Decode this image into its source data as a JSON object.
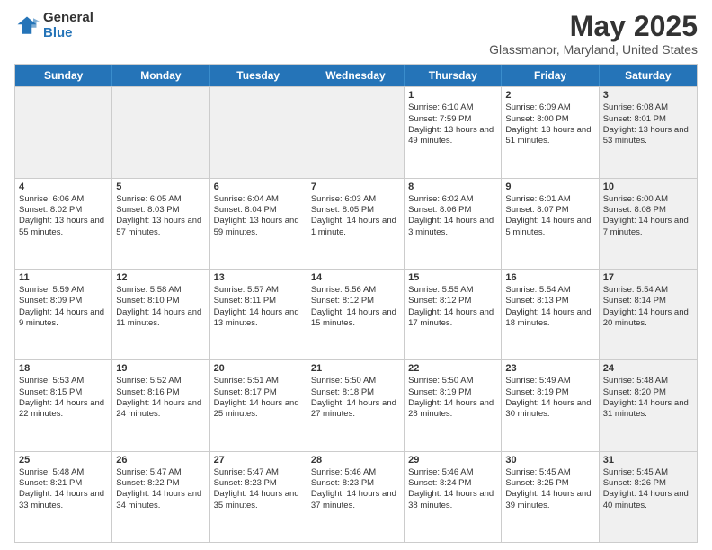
{
  "logo": {
    "general": "General",
    "blue": "Blue"
  },
  "header": {
    "month": "May 2025",
    "location": "Glassmanor, Maryland, United States"
  },
  "weekdays": [
    "Sunday",
    "Monday",
    "Tuesday",
    "Wednesday",
    "Thursday",
    "Friday",
    "Saturday"
  ],
  "rows": [
    [
      {
        "day": "",
        "sunrise": "",
        "sunset": "",
        "daylight": "",
        "shaded": true
      },
      {
        "day": "",
        "sunrise": "",
        "sunset": "",
        "daylight": "",
        "shaded": true
      },
      {
        "day": "",
        "sunrise": "",
        "sunset": "",
        "daylight": "",
        "shaded": true
      },
      {
        "day": "",
        "sunrise": "",
        "sunset": "",
        "daylight": "",
        "shaded": true
      },
      {
        "day": "1",
        "sunrise": "Sunrise: 6:10 AM",
        "sunset": "Sunset: 7:59 PM",
        "daylight": "Daylight: 13 hours and 49 minutes."
      },
      {
        "day": "2",
        "sunrise": "Sunrise: 6:09 AM",
        "sunset": "Sunset: 8:00 PM",
        "daylight": "Daylight: 13 hours and 51 minutes."
      },
      {
        "day": "3",
        "sunrise": "Sunrise: 6:08 AM",
        "sunset": "Sunset: 8:01 PM",
        "daylight": "Daylight: 13 hours and 53 minutes.",
        "shaded": true
      }
    ],
    [
      {
        "day": "4",
        "sunrise": "Sunrise: 6:06 AM",
        "sunset": "Sunset: 8:02 PM",
        "daylight": "Daylight: 13 hours and 55 minutes."
      },
      {
        "day": "5",
        "sunrise": "Sunrise: 6:05 AM",
        "sunset": "Sunset: 8:03 PM",
        "daylight": "Daylight: 13 hours and 57 minutes."
      },
      {
        "day": "6",
        "sunrise": "Sunrise: 6:04 AM",
        "sunset": "Sunset: 8:04 PM",
        "daylight": "Daylight: 13 hours and 59 minutes."
      },
      {
        "day": "7",
        "sunrise": "Sunrise: 6:03 AM",
        "sunset": "Sunset: 8:05 PM",
        "daylight": "Daylight: 14 hours and 1 minute."
      },
      {
        "day": "8",
        "sunrise": "Sunrise: 6:02 AM",
        "sunset": "Sunset: 8:06 PM",
        "daylight": "Daylight: 14 hours and 3 minutes."
      },
      {
        "day": "9",
        "sunrise": "Sunrise: 6:01 AM",
        "sunset": "Sunset: 8:07 PM",
        "daylight": "Daylight: 14 hours and 5 minutes."
      },
      {
        "day": "10",
        "sunrise": "Sunrise: 6:00 AM",
        "sunset": "Sunset: 8:08 PM",
        "daylight": "Daylight: 14 hours and 7 minutes.",
        "shaded": true
      }
    ],
    [
      {
        "day": "11",
        "sunrise": "Sunrise: 5:59 AM",
        "sunset": "Sunset: 8:09 PM",
        "daylight": "Daylight: 14 hours and 9 minutes."
      },
      {
        "day": "12",
        "sunrise": "Sunrise: 5:58 AM",
        "sunset": "Sunset: 8:10 PM",
        "daylight": "Daylight: 14 hours and 11 minutes."
      },
      {
        "day": "13",
        "sunrise": "Sunrise: 5:57 AM",
        "sunset": "Sunset: 8:11 PM",
        "daylight": "Daylight: 14 hours and 13 minutes."
      },
      {
        "day": "14",
        "sunrise": "Sunrise: 5:56 AM",
        "sunset": "Sunset: 8:12 PM",
        "daylight": "Daylight: 14 hours and 15 minutes."
      },
      {
        "day": "15",
        "sunrise": "Sunrise: 5:55 AM",
        "sunset": "Sunset: 8:12 PM",
        "daylight": "Daylight: 14 hours and 17 minutes."
      },
      {
        "day": "16",
        "sunrise": "Sunrise: 5:54 AM",
        "sunset": "Sunset: 8:13 PM",
        "daylight": "Daylight: 14 hours and 18 minutes."
      },
      {
        "day": "17",
        "sunrise": "Sunrise: 5:54 AM",
        "sunset": "Sunset: 8:14 PM",
        "daylight": "Daylight: 14 hours and 20 minutes.",
        "shaded": true
      }
    ],
    [
      {
        "day": "18",
        "sunrise": "Sunrise: 5:53 AM",
        "sunset": "Sunset: 8:15 PM",
        "daylight": "Daylight: 14 hours and 22 minutes."
      },
      {
        "day": "19",
        "sunrise": "Sunrise: 5:52 AM",
        "sunset": "Sunset: 8:16 PM",
        "daylight": "Daylight: 14 hours and 24 minutes."
      },
      {
        "day": "20",
        "sunrise": "Sunrise: 5:51 AM",
        "sunset": "Sunset: 8:17 PM",
        "daylight": "Daylight: 14 hours and 25 minutes."
      },
      {
        "day": "21",
        "sunrise": "Sunrise: 5:50 AM",
        "sunset": "Sunset: 8:18 PM",
        "daylight": "Daylight: 14 hours and 27 minutes."
      },
      {
        "day": "22",
        "sunrise": "Sunrise: 5:50 AM",
        "sunset": "Sunset: 8:19 PM",
        "daylight": "Daylight: 14 hours and 28 minutes."
      },
      {
        "day": "23",
        "sunrise": "Sunrise: 5:49 AM",
        "sunset": "Sunset: 8:19 PM",
        "daylight": "Daylight: 14 hours and 30 minutes."
      },
      {
        "day": "24",
        "sunrise": "Sunrise: 5:48 AM",
        "sunset": "Sunset: 8:20 PM",
        "daylight": "Daylight: 14 hours and 31 minutes.",
        "shaded": true
      }
    ],
    [
      {
        "day": "25",
        "sunrise": "Sunrise: 5:48 AM",
        "sunset": "Sunset: 8:21 PM",
        "daylight": "Daylight: 14 hours and 33 minutes."
      },
      {
        "day": "26",
        "sunrise": "Sunrise: 5:47 AM",
        "sunset": "Sunset: 8:22 PM",
        "daylight": "Daylight: 14 hours and 34 minutes."
      },
      {
        "day": "27",
        "sunrise": "Sunrise: 5:47 AM",
        "sunset": "Sunset: 8:23 PM",
        "daylight": "Daylight: 14 hours and 35 minutes."
      },
      {
        "day": "28",
        "sunrise": "Sunrise: 5:46 AM",
        "sunset": "Sunset: 8:23 PM",
        "daylight": "Daylight: 14 hours and 37 minutes."
      },
      {
        "day": "29",
        "sunrise": "Sunrise: 5:46 AM",
        "sunset": "Sunset: 8:24 PM",
        "daylight": "Daylight: 14 hours and 38 minutes."
      },
      {
        "day": "30",
        "sunrise": "Sunrise: 5:45 AM",
        "sunset": "Sunset: 8:25 PM",
        "daylight": "Daylight: 14 hours and 39 minutes."
      },
      {
        "day": "31",
        "sunrise": "Sunrise: 5:45 AM",
        "sunset": "Sunset: 8:26 PM",
        "daylight": "Daylight: 14 hours and 40 minutes.",
        "shaded": true
      }
    ]
  ]
}
